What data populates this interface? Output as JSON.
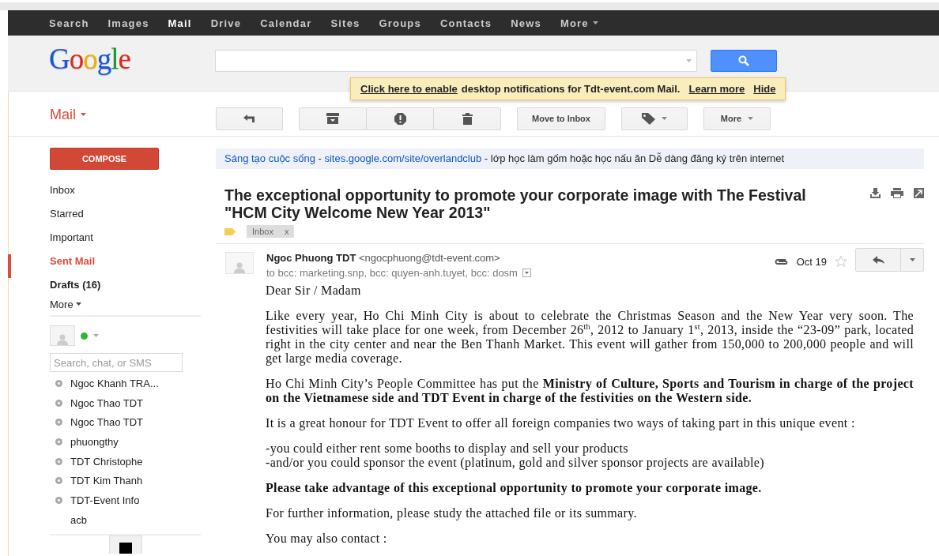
{
  "nav": [
    {
      "label": "Search",
      "selected": false
    },
    {
      "label": "Images",
      "selected": false
    },
    {
      "label": "Mail",
      "selected": true
    },
    {
      "label": "Drive",
      "selected": false
    },
    {
      "label": "Calendar",
      "selected": false
    },
    {
      "label": "Sites",
      "selected": false
    },
    {
      "label": "Groups",
      "selected": false
    },
    {
      "label": "Contacts",
      "selected": false
    },
    {
      "label": "News",
      "selected": false
    },
    {
      "label": "More",
      "selected": false,
      "kind": "menu"
    }
  ],
  "logo": "Google",
  "notification": {
    "link": "Click here to enable",
    "text": "desktop notifications for Tdt-event.com Mail.",
    "learn_more": "Learn more",
    "hide": "Hide"
  },
  "app_menu": "Mail",
  "toolbar": {
    "move_label": "Move to Inbox",
    "more_label": "More"
  },
  "compose": "COMPOSE",
  "folders": [
    {
      "label": "Inbox",
      "selected": false,
      "unread": false
    },
    {
      "label": "Starred",
      "selected": false,
      "unread": false
    },
    {
      "label": "Important",
      "selected": false,
      "unread": false
    },
    {
      "label": "Sent Mail",
      "selected": true,
      "unread": false
    },
    {
      "label": "Drafts (16)",
      "selected": false,
      "unread": true
    }
  ],
  "folders_more": "More",
  "chat_search": {
    "placeholder": "Search, chat, or SMS"
  },
  "contacts": [
    {
      "name": "Ngoc Khanh TRA...",
      "offline": true
    },
    {
      "name": "Ngoc Thao TDT",
      "offline": true
    },
    {
      "name": "Ngoc Thao TDT",
      "offline": true
    },
    {
      "name": "phuongthy",
      "offline": true
    },
    {
      "name": "TDT Christophe",
      "offline": true
    },
    {
      "name": "TDT Kim Thanh",
      "offline": true
    },
    {
      "name": "TDT-Event Info",
      "offline": true
    },
    {
      "name": "acb",
      "offline": false
    }
  ],
  "ad": [
    {
      "kind": "link",
      "text": "Sáng tạo cuộc sống"
    },
    {
      "kind": "plain",
      "text": " - "
    },
    {
      "kind": "link",
      "text": "sites.google.com/site/overlandclub"
    },
    {
      "kind": "plain",
      "text": " - lớp học làm gốm hoặc học nấu ăn Dễ dàng đăng ký trên internet"
    }
  ],
  "subject": "The exceptional opportunity to promote your corporate image with The Festival \"HCM City Welcome New Year 2013\"",
  "label": {
    "text": "Inbox",
    "remove": "x"
  },
  "message": {
    "sender_name": "Ngoc Phuong TDT",
    "sender_email": "<ngocphuong@tdt-event.com>",
    "recipients": "to bcc: marketing.snp, bcc: quyen-anh.tuyet, bcc: dosm",
    "date": "Oct 19",
    "starred": false
  },
  "body": [
    {
      "kind": "text",
      "text": "Dear Sir / Madam"
    },
    {
      "kind": "text",
      "text": "Like every year, Ho Chi Minh City is about to celebrate the Christmas Season and the New Year very soon. The festivities will take place for one week, from December 26$^{th}$, 2012 to January 1$^{st}$, 2013, inside the “23-09” park, located right in the city center and near the Ben Thanh Market. This event will gather from 150,000 to 200,000 people and will get large media coverage."
    },
    {
      "kind": "text",
      "text": "Ho Chi Minh City’s People Committee has put the **Ministry of Culture, Sports and  Tourism in charge of the project on the Vietnamese side and TDT Event in charge of the festivities on the Western side.**"
    },
    {
      "kind": "text",
      "text": "It is a great honour for TDT Event to offer all foreign companies two ways of taking part in this unique event :"
    },
    {
      "kind": "lines",
      "lines": [
        "-you could either rent some booths to display and sell your products",
        "-and/or you could sponsor the event (platinum, gold and silver sponsor projects are available)"
      ]
    },
    {
      "kind": "bold",
      "text": "Please take advantage of this exceptional opportunity to promote your corporate image."
    },
    {
      "kind": "text",
      "text": "For further information, please study the attached file or its summary."
    },
    {
      "kind": "text",
      "text": "You may also contact :"
    }
  ]
}
